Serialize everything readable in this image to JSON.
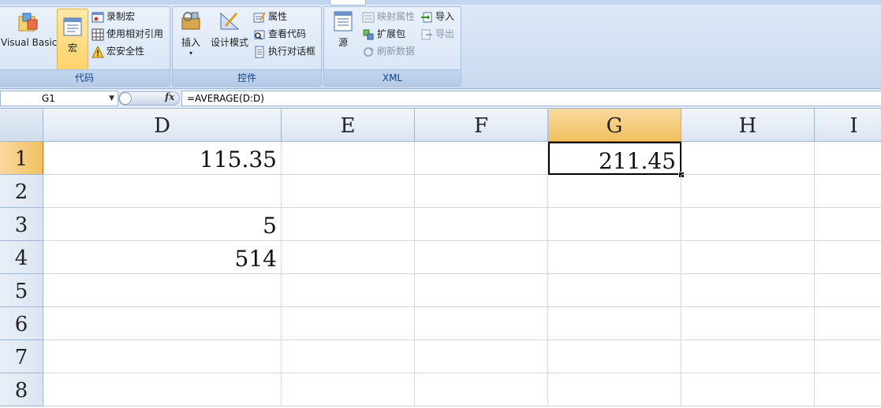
{
  "ribbon": {
    "groups": {
      "code": {
        "label": "代码",
        "visual_basic": "Visual Basic",
        "macros": "宏",
        "record_macro": "录制宏",
        "use_relative_refs": "使用相对引用",
        "macro_security": "宏安全性"
      },
      "controls": {
        "label": "控件",
        "insert": "插入",
        "design_mode": "设计模式",
        "properties": "属性",
        "view_code": "查看代码",
        "run_dialog": "执行对话框"
      },
      "xml": {
        "label": "XML",
        "source": "源",
        "map_properties": "映射属性",
        "expansion_packs": "扩展包",
        "refresh_data": "刷新数据",
        "import": "导入",
        "export": "导出"
      }
    }
  },
  "formula_bar": {
    "name_box": "G1",
    "fx": "fx",
    "formula": "=AVERAGE(D:D)"
  },
  "grid": {
    "columns": [
      "D",
      "E",
      "F",
      "G",
      "H",
      "I"
    ],
    "rows": [
      "1",
      "2",
      "3",
      "4",
      "5",
      "6",
      "7",
      "8"
    ],
    "selected_column": "G",
    "selected_row": "1",
    "cells": {
      "D1": "115.35",
      "D3": "5",
      "D4": "514",
      "G1": "211.45"
    }
  },
  "colors": {
    "selection_header": "#f1c15f",
    "grid_line": "#d0d7e5",
    "ribbon_label": "#15428b"
  }
}
